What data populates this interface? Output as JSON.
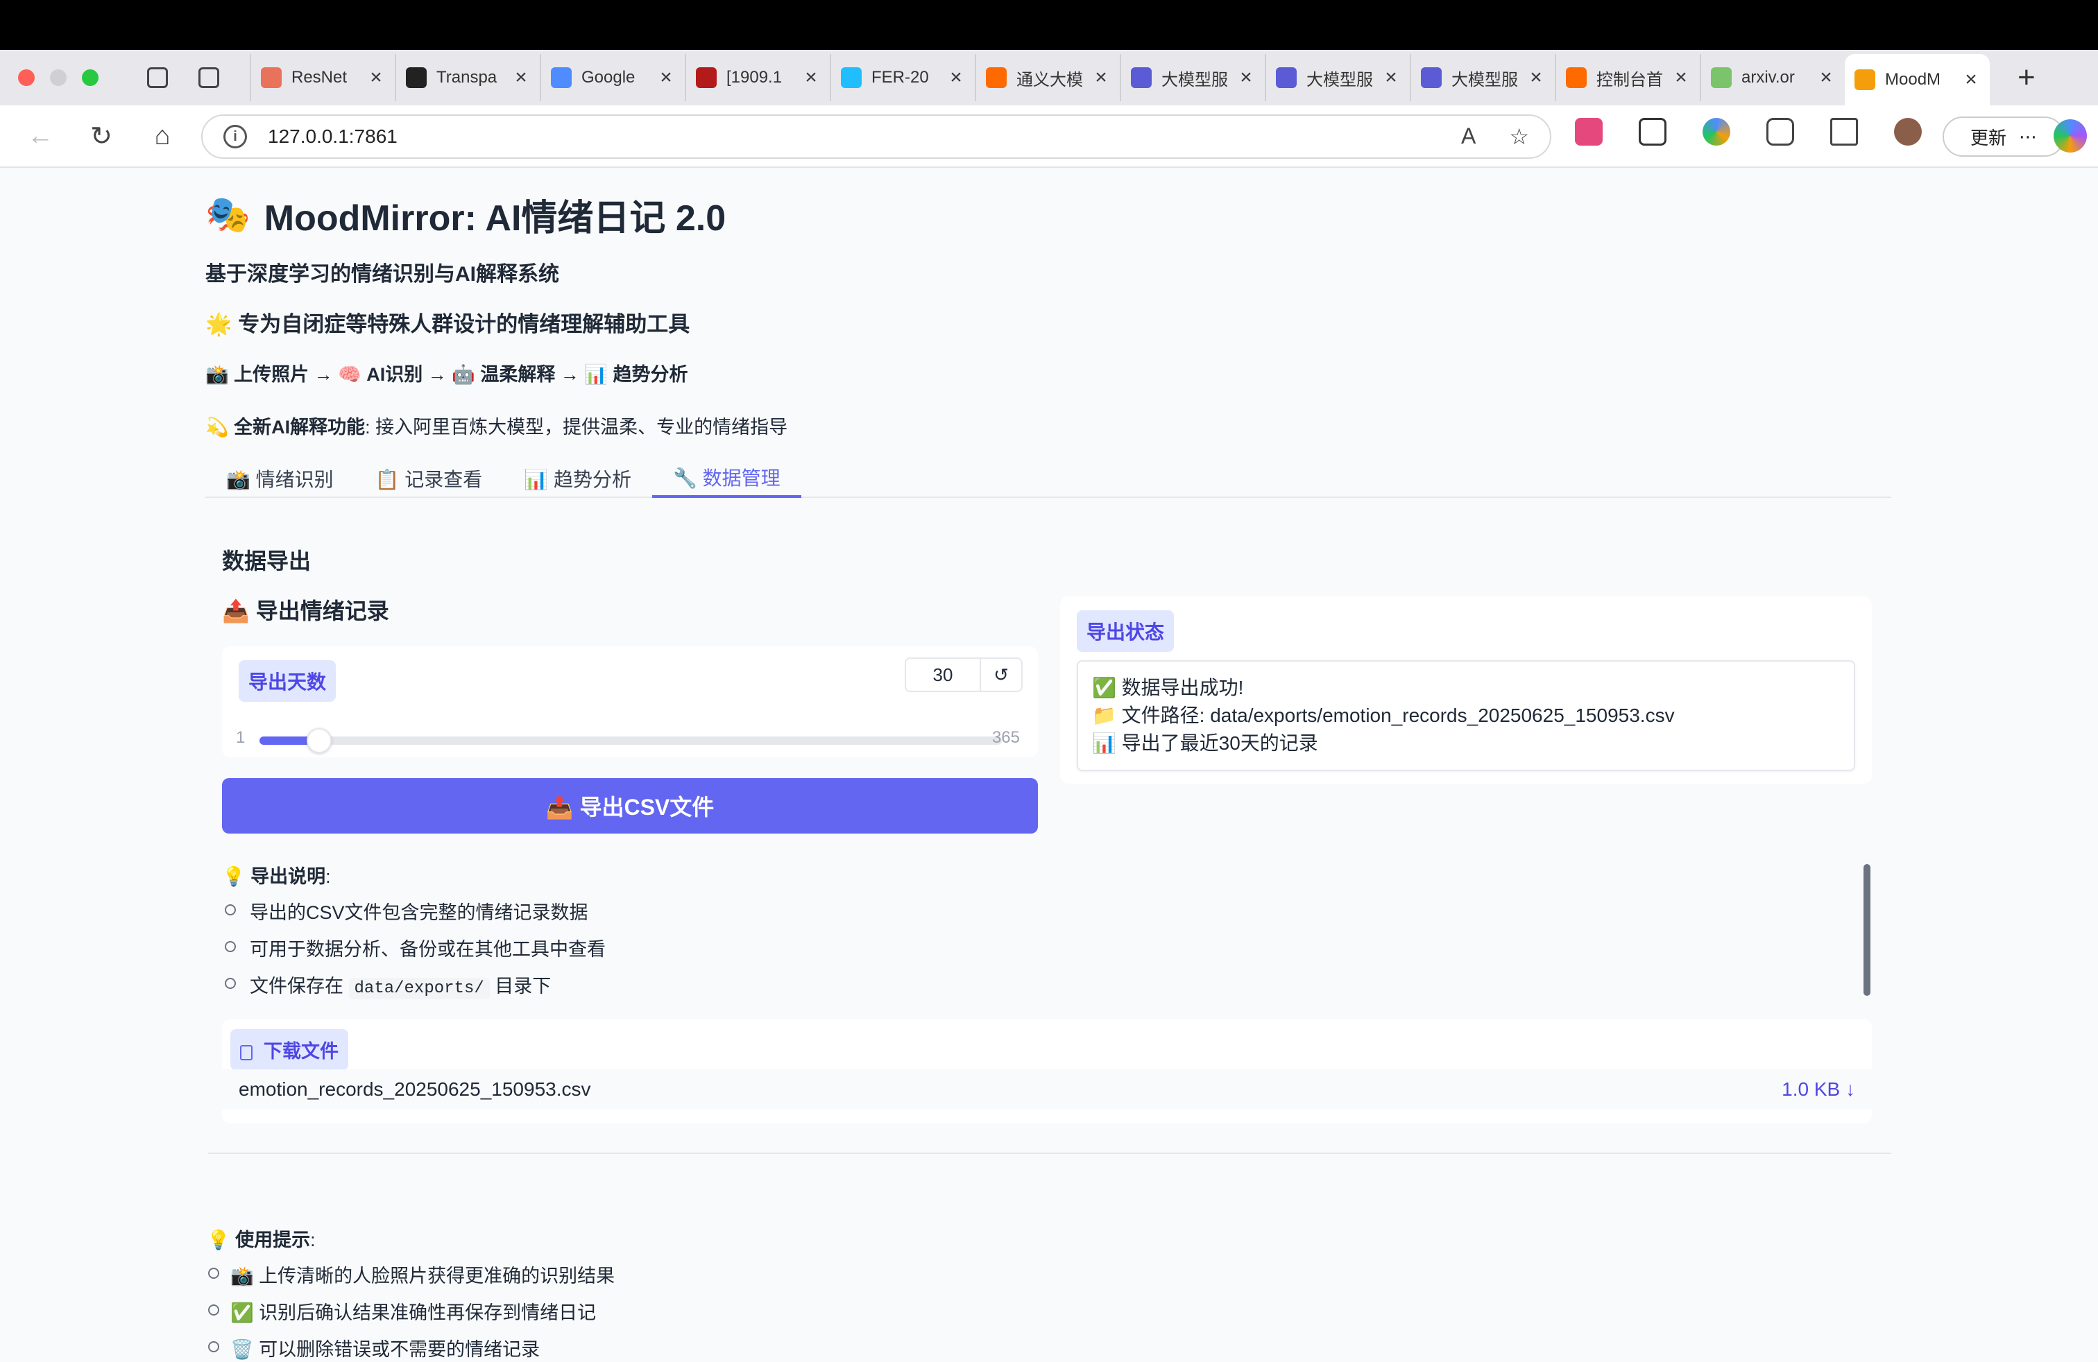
{
  "browser": {
    "tabs": [
      {
        "label": "ResNet",
        "icon": "c-icon",
        "color": "#e8735a"
      },
      {
        "label": "Transpa",
        "icon": "github-icon",
        "color": "#222222"
      },
      {
        "label": "Google",
        "icon": "gemini-icon",
        "color": "#4f8cff"
      },
      {
        "label": "[1909.1",
        "icon": "arxiv-icon",
        "color": "#b31b1b"
      },
      {
        "label": "FER-20",
        "icon": "kaggle-icon",
        "color": "#20beff"
      },
      {
        "label": "通义大模",
        "icon": "aliyun-icon",
        "color": "#ff6a00"
      },
      {
        "label": "大模型服",
        "icon": "model-icon",
        "color": "#5b5bd6"
      },
      {
        "label": "大模型服",
        "icon": "model-icon",
        "color": "#5b5bd6"
      },
      {
        "label": "大模型服",
        "icon": "model-icon",
        "color": "#5b5bd6"
      },
      {
        "label": "控制台首",
        "icon": "aliyun-icon",
        "color": "#ff6a00"
      },
      {
        "label": "arxiv.or",
        "icon": "arxiv-or-icon",
        "color": "#7cc46b"
      },
      {
        "label": "MoodM",
        "icon": "gradio-icon",
        "color": "#f59e0b"
      }
    ],
    "url": "127.0.0.1:7861",
    "update_label": "更新",
    "more_label": "⋯"
  },
  "app": {
    "emoji": "🎭",
    "title": "MoodMirror: AI情绪日记 2.0",
    "subtitle": "基于深度学习的情绪识别与AI解释系统",
    "tagline": "🌟 专为自闭症等特殊人群设计的情绪理解辅助工具",
    "flow": "📸 上传照片 → 🧠 AI识别 → 🤖 温柔解释 → 📊 趋势分析",
    "feature_bold": "💫 全新AI解释功能",
    "feature_rest": ": 接入阿里百炼大模型，提供温柔、专业的情绪指导",
    "tabs": [
      "📸 情绪识别",
      "📋 记录查看",
      "📊 趋势分析",
      "🔧 数据管理"
    ],
    "active_tab": 3
  },
  "export": {
    "section_title": "数据导出",
    "subsection_title": "📤 导出情绪记录",
    "days_label": "导出天数",
    "days_value": "30",
    "days_min": "1",
    "days_max": "365",
    "days_fraction": 0.08,
    "reset_icon": "↺",
    "button_label": "📤 导出CSV文件",
    "status_label": "导出状态",
    "status_lines": [
      "✅ 数据导出成功!",
      "📁 文件路径: data/exports/emotion_records_20250625_150953.csv",
      "📊 导出了最近30天的记录"
    ],
    "notes_title": "导出说明",
    "notes": [
      "导出的CSV文件包含完整的情绪记录数据",
      "可用于数据分析、备份或在其他工具中查看"
    ],
    "note3_pre": "文件保存在 ",
    "note3_code": "data/exports/",
    "note3_post": " 目录下",
    "download_label": "下载文件",
    "file_name": "emotion_records_20250625_150953.csv",
    "file_size": "1.0 KB ↓"
  },
  "tips": {
    "title": "使用提示",
    "items": [
      "📸 上传清晰的人脸照片获得更准确的识别结果",
      "✅ 识别后确认结果准确性再保存到情绪日记",
      "🗑️ 可以删除错误或不需要的情绪记录"
    ]
  }
}
